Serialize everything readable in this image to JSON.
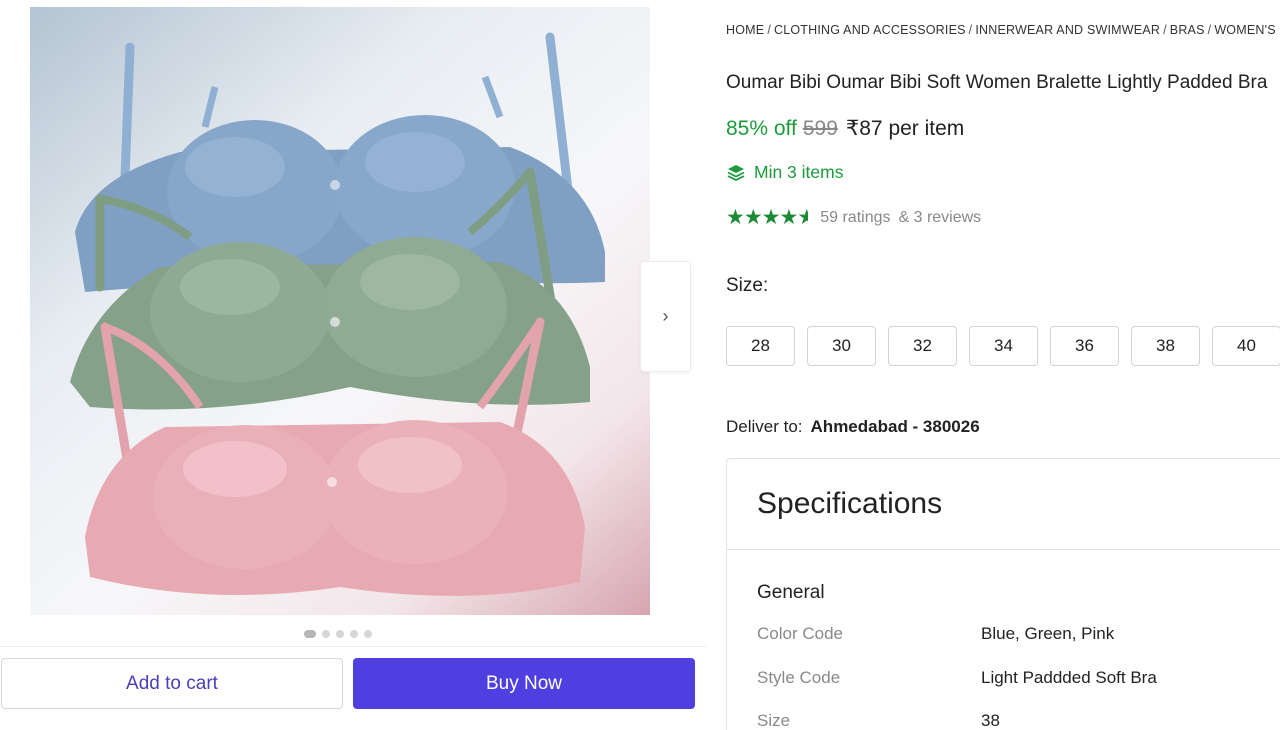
{
  "gallery": {
    "image_alt_icon": "bra-product-photo",
    "next_icon": "›",
    "dots": [
      true,
      false,
      false,
      false,
      false
    ]
  },
  "actions": {
    "add_to_cart": "Add to cart",
    "buy_now": "Buy Now"
  },
  "breadcrumb": [
    "HOME",
    "CLOTHING AND ACCESSORIES",
    "INNERWEAR AND SWIMWEAR",
    "BRAS",
    "WOMEN'S BRAS"
  ],
  "product": {
    "title": "Oumar Bibi Oumar Bibi Soft Women Bralette Lightly Padded Bra",
    "discount": "85% off",
    "mrp": "599",
    "price": "₹87 per item",
    "min_items": "Min 3 items",
    "rating_stars": 4.5,
    "ratings": "59 ratings",
    "reviews": "& 3 reviews"
  },
  "size": {
    "label": "Size:",
    "options": [
      "28",
      "30",
      "32",
      "34",
      "36",
      "38",
      "40"
    ]
  },
  "delivery": {
    "label": "Deliver to:",
    "location": "Ahmedabad - 380026"
  },
  "specifications": {
    "title": "Specifications",
    "group": "General",
    "rows": [
      {
        "key": "Color Code",
        "value": "Blue, Green, Pink"
      },
      {
        "key": "Style Code",
        "value": "Light Paddded Soft Bra"
      },
      {
        "key": "Size",
        "value": "38"
      }
    ]
  },
  "colors": {
    "accent": "#4f3fe0",
    "green": "#1d9b3c",
    "bra_blue": "#7d9ec2",
    "bra_green": "#8aa58d",
    "bra_pink": "#e3a6ae"
  }
}
